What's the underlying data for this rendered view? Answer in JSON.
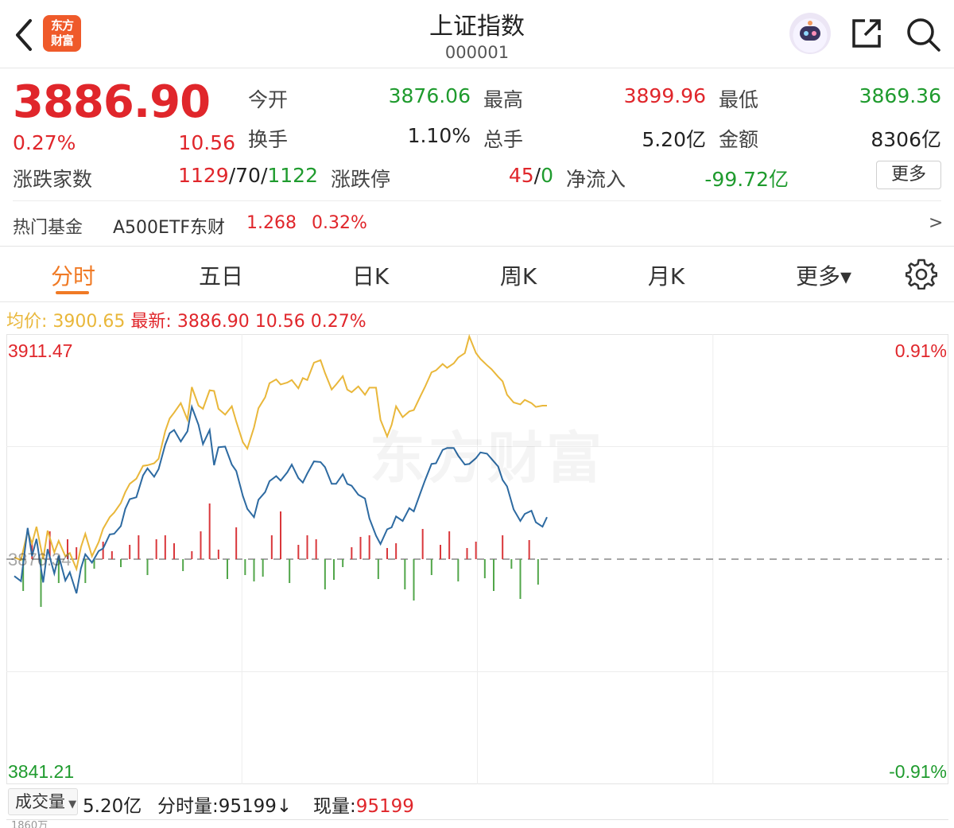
{
  "header": {
    "title": "上证指数",
    "code": "000001",
    "logo_line1": "东方",
    "logo_line2": "财富"
  },
  "quote": {
    "price": "3886.90",
    "change_pct": "0.27%",
    "change": "10.56",
    "open_label": "今开",
    "open_value": "3876.06",
    "high_label": "最高",
    "high_value": "3899.96",
    "low_label": "最低",
    "low_value": "3869.36",
    "turnover_label": "换手",
    "turnover_value": "1.10%",
    "total_hands_label": "总手",
    "total_hands_value": "5.20亿",
    "amount_label": "金额",
    "amount_value": "8306亿",
    "breadth_label": "涨跌家数",
    "breadth_up": "1129",
    "breadth_sep1": "/",
    "breadth_flat": "70",
    "breadth_sep2": "/",
    "breadth_down": "1122",
    "limit_label": "涨跌停",
    "limit_up": "45",
    "limit_sep": "/",
    "limit_down": "0",
    "netflow_label": "净流入",
    "netflow_value": "-99.72亿",
    "more_label": "更多"
  },
  "hot_fund": {
    "label": "热门基金",
    "name": "A500ETF东财",
    "price": "1.268",
    "change_pct": "0.32%",
    "arrow": ">"
  },
  "tabs": [
    {
      "label": "分时",
      "active": true
    },
    {
      "label": "五日"
    },
    {
      "label": "日K"
    },
    {
      "label": "周K"
    },
    {
      "label": "月K"
    },
    {
      "label": "更多▾"
    }
  ],
  "legend": {
    "avg_label": "均价:",
    "avg_value": "3900.65",
    "latest_label": "最新:",
    "latest_value": "3886.90",
    "change": "10.56",
    "change_pct": "0.27%"
  },
  "chart_data": {
    "type": "line",
    "title": "",
    "y_max_label": "3911.47",
    "y_min_label": "3841.21",
    "pct_max_label": "0.91%",
    "pct_min_label": "-0.91%",
    "prev_close_label": "3876.34",
    "ylim": [
      3841.21,
      3911.47
    ],
    "prev_close": 3876.34,
    "session_minutes": 240,
    "colors": {
      "index": "#2d6aa1",
      "average": "#e9b73a",
      "up_bar": "#d9373b",
      "down_bar": "#52a64a",
      "baseline": "#888888"
    },
    "series": [
      {
        "name": "",
        "color": "#2d6aa1",
        "x": [
          0,
          3,
          6,
          8,
          10,
          13,
          15,
          18,
          20,
          23,
          25,
          28,
          30,
          32,
          35,
          38,
          40,
          43,
          45,
          48,
          50,
          52,
          55,
          58,
          60,
          63,
          65,
          68,
          70,
          72,
          75,
          78,
          80,
          83,
          85,
          88,
          90,
          92,
          95,
          98,
          100,
          103,
          105,
          108,
          110,
          113,
          115,
          118,
          120,
          123,
          125,
          128,
          130,
          132,
          135,
          138,
          140,
          143,
          145,
          148,
          150,
          152,
          155,
          158,
          160,
          163,
          165,
          168,
          170,
          172,
          175,
          178,
          180,
          183,
          185,
          188,
          190,
          193,
          195,
          198,
          200,
          203,
          205,
          208,
          210,
          213,
          215,
          218,
          220,
          222,
          225,
          228,
          230,
          233,
          235,
          238,
          240
        ],
        "values": [
          3873.7,
          3872.9,
          3881.2,
          3876.8,
          3879.5,
          3872.7,
          3877.9,
          3874.1,
          3876.9,
          3873.0,
          3874.3,
          3871.0,
          3874.9,
          3877.1,
          3875.8,
          3877.6,
          3878.0,
          3880.2,
          3880.3,
          3881.5,
          3884.2,
          3885.7,
          3886.0,
          3889.4,
          3890.5,
          3889.2,
          3890.4,
          3894.2,
          3896.0,
          3896.5,
          3894.7,
          3896.3,
          3900.1,
          3897.3,
          3894.3,
          3896.5,
          3891.0,
          3893.8,
          3893.9,
          3891.1,
          3890.1,
          3886.2,
          3884.2,
          3882.9,
          3885.6,
          3886.8,
          3888.5,
          3889.3,
          3888.6,
          3889.9,
          3891.1,
          3889.0,
          3888.3,
          3889.7,
          3891.6,
          3891.5,
          3890.7,
          3888.1,
          3888.1,
          3889.6,
          3888.1,
          3887.8,
          3886.4,
          3885.8,
          3882.7,
          3880.0,
          3878.7,
          3881.0,
          3881.3,
          3883.0,
          3882.3,
          3884.3,
          3883.8,
          3886.7,
          3888.6,
          3891.2,
          3891.3,
          3893.4,
          3893.7,
          3893.7,
          3892.5,
          3891.1,
          3891.2,
          3892.1,
          3893.0,
          3892.8,
          3892.0,
          3890.8,
          3888.7,
          3887.7,
          3884.1,
          3882.3,
          3883.4,
          3883.9,
          3882.1,
          3881.4,
          3882.9
        ]
      },
      {
        "name": "",
        "color": "#e9b73a",
        "x": [
          0,
          3,
          6,
          8,
          10,
          13,
          15,
          18,
          20,
          23,
          25,
          28,
          30,
          32,
          35,
          38,
          40,
          43,
          45,
          48,
          50,
          52,
          55,
          58,
          60,
          63,
          65,
          68,
          70,
          72,
          75,
          78,
          80,
          83,
          85,
          88,
          90,
          92,
          95,
          98,
          100,
          103,
          105,
          108,
          110,
          113,
          115,
          118,
          120,
          123,
          125,
          128,
          130,
          132,
          135,
          138,
          140,
          143,
          145,
          148,
          150,
          152,
          155,
          158,
          160,
          163,
          165,
          168,
          170,
          172,
          175,
          178,
          180,
          183,
          185,
          188,
          190,
          193,
          195,
          198,
          200,
          203,
          205,
          208,
          210,
          213,
          215,
          218,
          220,
          222,
          225,
          228,
          230,
          233,
          235,
          238,
          240
        ],
        "values": [
          3876.6,
          3876.2,
          3880.7,
          3878.8,
          3881.4,
          3876.3,
          3880.8,
          3877.4,
          3879.2,
          3876.8,
          3877.3,
          3874.8,
          3878.2,
          3880.3,
          3876.8,
          3879.0,
          3881.1,
          3882.9,
          3883.6,
          3885.1,
          3886.8,
          3888.1,
          3888.9,
          3890.9,
          3891.0,
          3891.3,
          3892.0,
          3896.3,
          3898.3,
          3899.2,
          3900.7,
          3898.1,
          3903.2,
          3900.3,
          3899.8,
          3902.7,
          3902.6,
          3899.8,
          3898.9,
          3900.2,
          3897.8,
          3894.6,
          3893.6,
          3896.9,
          3899.9,
          3901.6,
          3903.8,
          3904.4,
          3903.6,
          3903.9,
          3904.3,
          3903.0,
          3904.6,
          3904.3,
          3907.0,
          3907.4,
          3905.4,
          3902.8,
          3903.6,
          3904.9,
          3902.8,
          3902.4,
          3903.3,
          3902.0,
          3903.1,
          3903.1,
          3898.1,
          3895.5,
          3897.3,
          3900.2,
          3898.5,
          3899.4,
          3899.6,
          3901.8,
          3903.2,
          3905.5,
          3905.8,
          3906.8,
          3906.2,
          3906.9,
          3907.8,
          3908.5,
          3911.1,
          3908.5,
          3907.6,
          3906.6,
          3906.0,
          3904.8,
          3904.1,
          3902.0,
          3900.8,
          3900.5,
          3901.2,
          3900.7,
          3900.1,
          3900.3,
          3900.3
        ]
      }
    ],
    "volume_bars": {
      "x": [
        4,
        8,
        12,
        16,
        20,
        24,
        28,
        32,
        36,
        40,
        44,
        48,
        52,
        56,
        60,
        64,
        68,
        72,
        76,
        80,
        84,
        88,
        92,
        96,
        100,
        104,
        108,
        112,
        116,
        120,
        124,
        128,
        132,
        136,
        140,
        144,
        148,
        152,
        156,
        160,
        164,
        168,
        172,
        176,
        180,
        184,
        188,
        192,
        196,
        200,
        204,
        208,
        212,
        216,
        220,
        224,
        228,
        232,
        236
      ],
      "values": [
        -40,
        20,
        -60,
        35,
        -30,
        25,
        15,
        -30,
        -12,
        22,
        10,
        -10,
        18,
        30,
        -20,
        25,
        30,
        20,
        -15,
        10,
        35,
        70,
        12,
        -25,
        40,
        -20,
        -28,
        -22,
        30,
        60,
        -30,
        18,
        30,
        25,
        -38,
        -26,
        -10,
        15,
        28,
        30,
        -25,
        14,
        20,
        -38,
        -52,
        38,
        -20,
        18,
        35,
        -28,
        14,
        22,
        -24,
        -40,
        30,
        -12,
        -50,
        24,
        -32
      ],
      "max_label": "1860万"
    }
  },
  "volume": {
    "select_label": "成交量",
    "total": "5.20亿",
    "minute_label": "分时量:",
    "minute_value": "95199",
    "minute_arrow": "↓",
    "current_label": "现量:",
    "current_value": "95199"
  },
  "watermark": "东方财富"
}
